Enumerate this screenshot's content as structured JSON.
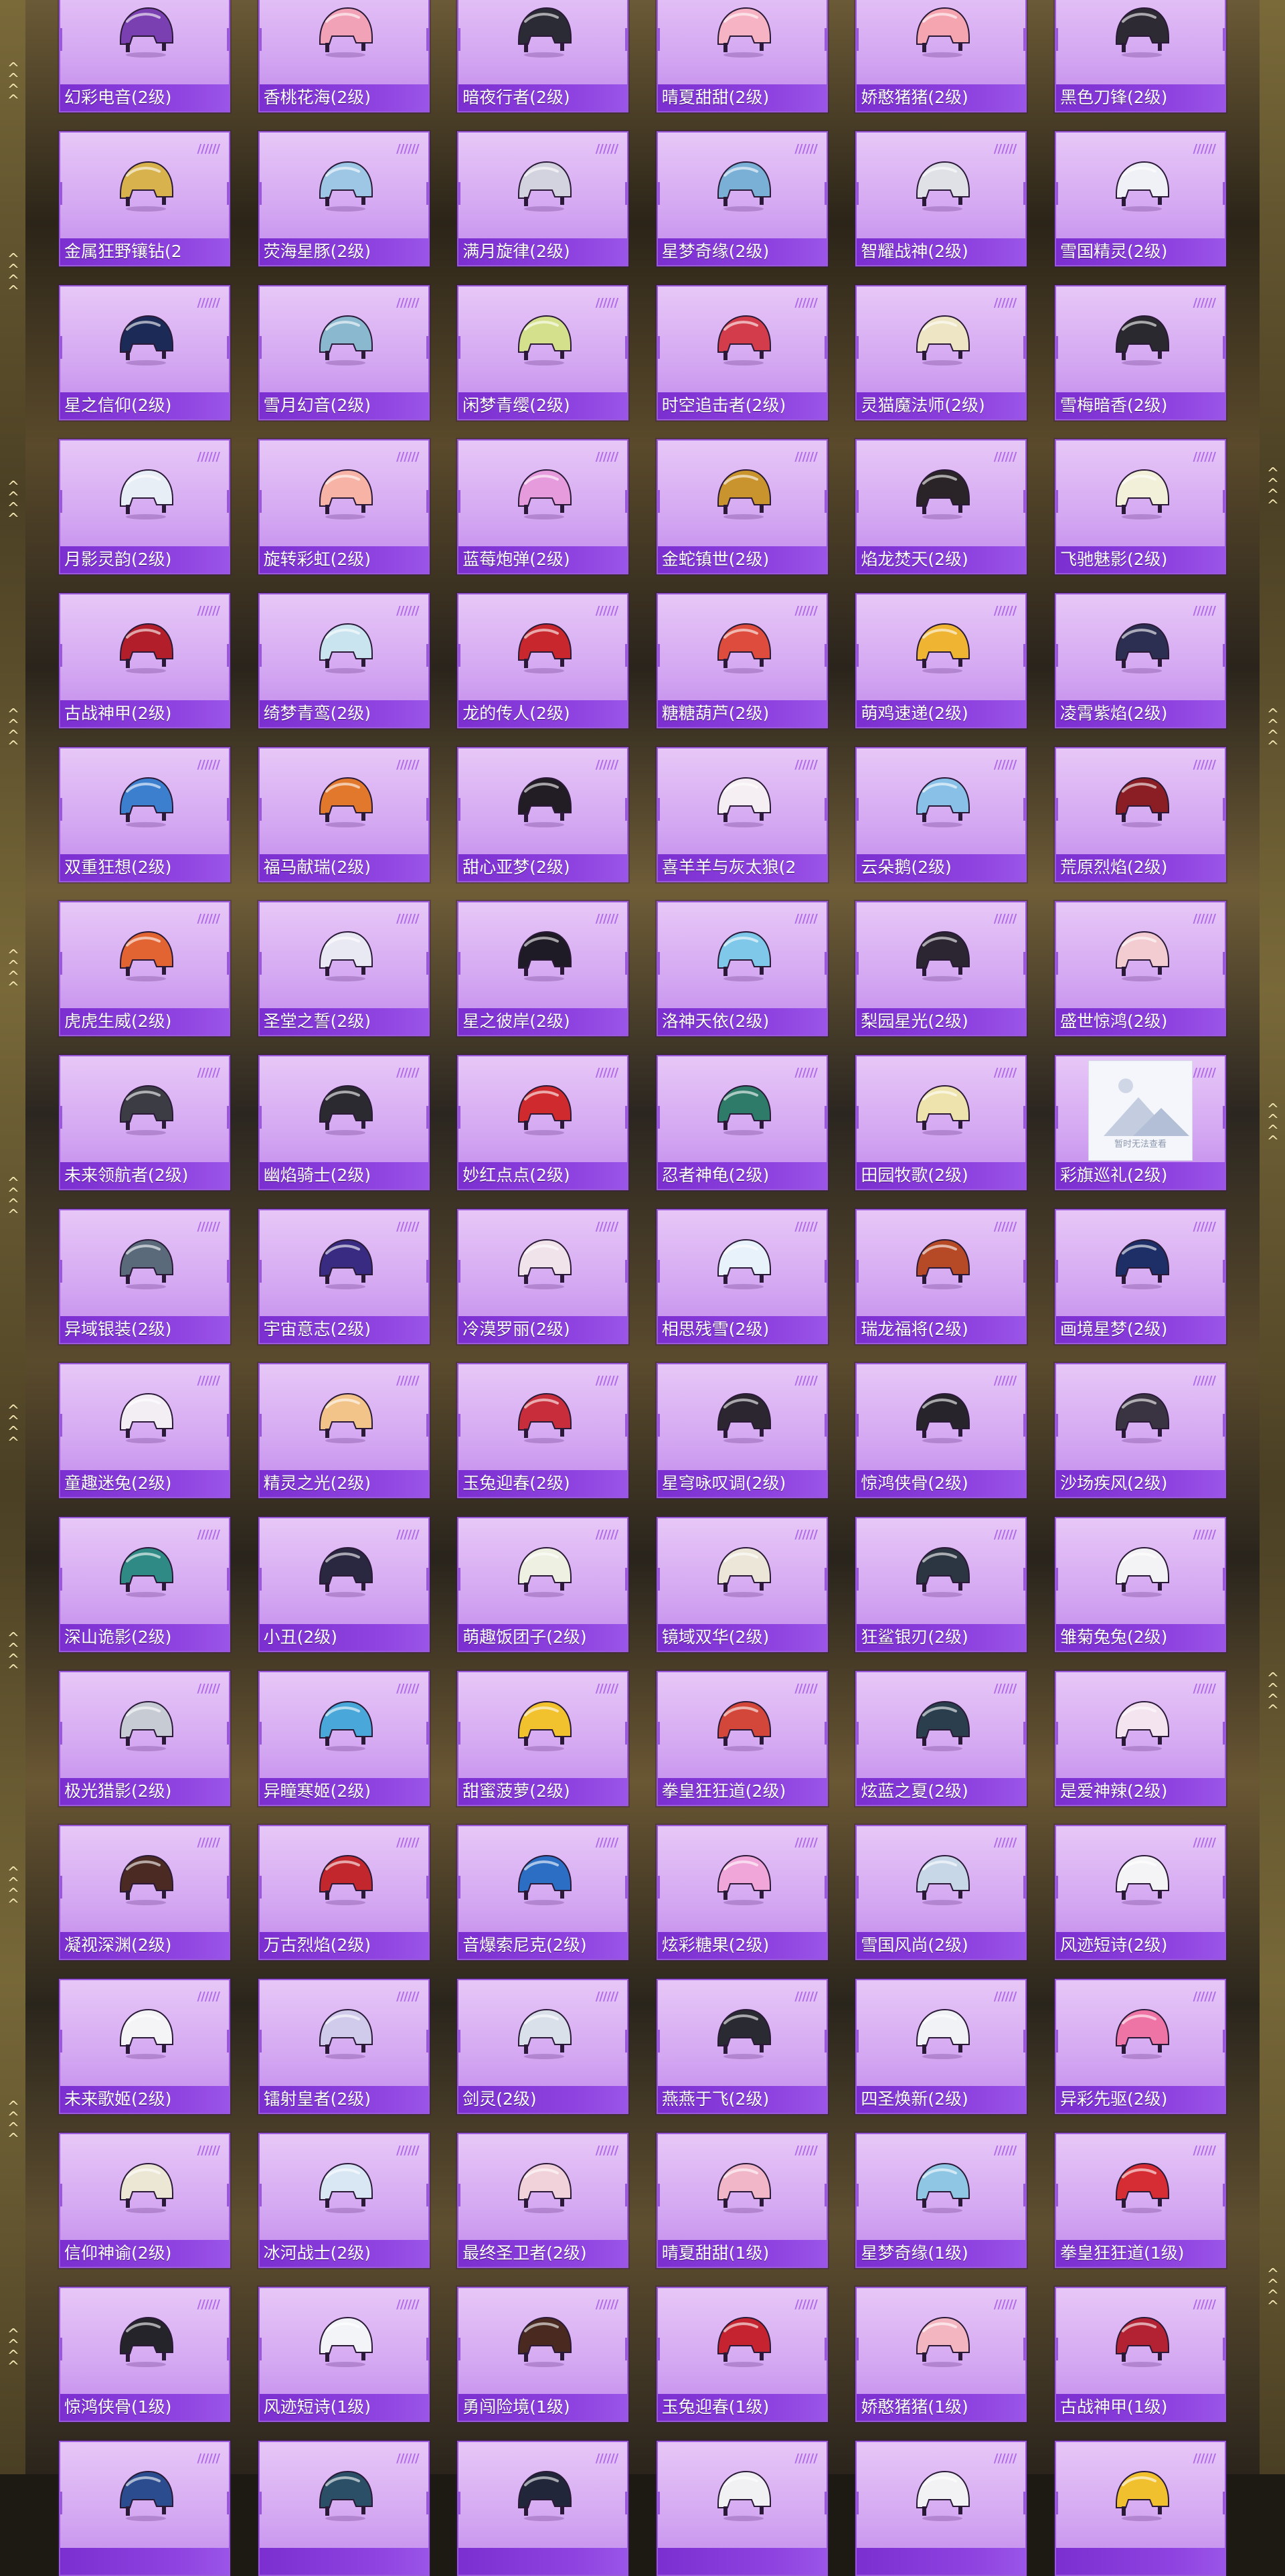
{
  "placeholder_text": "暂时无法查看",
  "items": [
    {
      "name": "幻彩电音(2级)",
      "color": "#7a3fb0"
    },
    {
      "name": "香桃花海(2级)",
      "color": "#f2a2b7"
    },
    {
      "name": "暗夜行者(2级)",
      "color": "#2b2b35"
    },
    {
      "name": "晴夏甜甜(2级)",
      "color": "#f5b3c3"
    },
    {
      "name": "娇憨猪猪(2级)",
      "color": "#f4a5b0"
    },
    {
      "name": "黑色刀锋(2级)",
      "color": "#2d2a34"
    },
    {
      "name": "金属狂野镶钻(2",
      "color": "#d8b24d"
    },
    {
      "name": "荧海星豚(2级)",
      "color": "#9ec7e6"
    },
    {
      "name": "满月旋律(2级)",
      "color": "#d3d3df"
    },
    {
      "name": "星梦奇缘(2级)",
      "color": "#7bb0d6"
    },
    {
      "name": "智耀战神(2级)",
      "color": "#dfe1e7"
    },
    {
      "name": "雪国精灵(2级)",
      "color": "#f0f1f6"
    },
    {
      "name": "星之信仰(2级)",
      "color": "#1c2a57"
    },
    {
      "name": "雪月幻音(2级)",
      "color": "#8ab8cf"
    },
    {
      "name": "闲梦青缨(2级)",
      "color": "#d4e08b"
    },
    {
      "name": "时空追击者(2级)",
      "color": "#d33d4b"
    },
    {
      "name": "灵猫魔法师(2级)",
      "color": "#eee5c4"
    },
    {
      "name": "雪梅暗香(2级)",
      "color": "#2b2930"
    },
    {
      "name": "月影灵韵(2级)",
      "color": "#e8eef6"
    },
    {
      "name": "旋转彩虹(2级)",
      "color": "#f7b3a6"
    },
    {
      "name": "蓝莓炮弹(2级)",
      "color": "#e69bdc"
    },
    {
      "name": "金蛇镇世(2级)",
      "color": "#c9932d"
    },
    {
      "name": "焰龙焚天(2级)",
      "color": "#2a2327"
    },
    {
      "name": "飞驰魅影(2级)",
      "color": "#f2f0d8"
    },
    {
      "name": "古战神甲(2级)",
      "color": "#b21f2a"
    },
    {
      "name": "绮梦青鸾(2级)",
      "color": "#c9e3ef"
    },
    {
      "name": "龙的传人(2级)",
      "color": "#c8282d"
    },
    {
      "name": "糖糖葫芦(2级)",
      "color": "#dd4c3c"
    },
    {
      "name": "萌鸡速递(2级)",
      "color": "#efb431"
    },
    {
      "name": "凌霄紫焰(2级)",
      "color": "#2d2f52"
    },
    {
      "name": "双重狂想(2级)",
      "color": "#3c7fcf"
    },
    {
      "name": "福马献瑞(2级)",
      "color": "#e2782c"
    },
    {
      "name": "甜心亚梦(2级)",
      "color": "#221d24"
    },
    {
      "name": "喜羊羊与灰太狼(2",
      "color": "#f5eef2"
    },
    {
      "name": "云朵鹅(2级)",
      "color": "#88c0e7"
    },
    {
      "name": "荒原烈焰(2级)",
      "color": "#8b1e25"
    },
    {
      "name": "虎虎生威(2级)",
      "color": "#e16432"
    },
    {
      "name": "圣堂之誓(2级)",
      "color": "#e9e9f4"
    },
    {
      "name": "星之彼岸(2级)",
      "color": "#1f1b26"
    },
    {
      "name": "洛神天依(2级)",
      "color": "#7fc8e9"
    },
    {
      "name": "梨园星光(2级)",
      "color": "#2b2631"
    },
    {
      "name": "盛世惊鸿(2级)",
      "color": "#f2ccd1"
    },
    {
      "name": "未来领航者(2级)",
      "color": "#3b3c44"
    },
    {
      "name": "幽焰骑士(2级)",
      "color": "#2b2a31"
    },
    {
      "name": "妙红点点(2级)",
      "color": "#cf2b2f"
    },
    {
      "name": "忍者神龟(2级)",
      "color": "#2f7b6a"
    },
    {
      "name": "田园牧歌(2级)",
      "color": "#eee3ad"
    },
    {
      "name": "彩旗巡礼(2级)",
      "color": "#f5f6fb",
      "placeholder": true
    },
    {
      "name": "异域银装(2级)",
      "color": "#5a6a7a"
    },
    {
      "name": "宇宙意志(2级)",
      "color": "#3a2b82"
    },
    {
      "name": "冷漠罗丽(2级)",
      "color": "#f1e3ea"
    },
    {
      "name": "相思残雪(2级)",
      "color": "#e8f2fa"
    },
    {
      "name": "瑞龙福将(2级)",
      "color": "#b64a26"
    },
    {
      "name": "画境星梦(2级)",
      "color": "#1d2f66"
    },
    {
      "name": "童趣迷兔(2级)",
      "color": "#f3eef3"
    },
    {
      "name": "精灵之光(2级)",
      "color": "#f2c48a"
    },
    {
      "name": "玉兔迎春(2级)",
      "color": "#c82d3b"
    },
    {
      "name": "星穹咏叹调(2级)",
      "color": "#2c2631"
    },
    {
      "name": "惊鸿侠骨(2级)",
      "color": "#27252b"
    },
    {
      "name": "沙场疾风(2级)",
      "color": "#3a3442"
    },
    {
      "name": "深山诡影(2级)",
      "color": "#2f8a86"
    },
    {
      "name": "小丑(2级)",
      "color": "#2a2740"
    },
    {
      "name": "萌趣饭团子(2级)",
      "color": "#eef0e1"
    },
    {
      "name": "镜域双华(2级)",
      "color": "#ece6d8"
    },
    {
      "name": "狂鲨银刃(2级)",
      "color": "#2c3542"
    },
    {
      "name": "雏菊兔兔(2级)",
      "color": "#f3f3f5"
    },
    {
      "name": "极光猎影(2级)",
      "color": "#c7cbd4"
    },
    {
      "name": "异瞳寒姬(2级)",
      "color": "#4aa7d9"
    },
    {
      "name": "甜蜜菠萝(2级)",
      "color": "#f1c12e"
    },
    {
      "name": "拳皇狂狂道(2级)",
      "color": "#d3473a"
    },
    {
      "name": "炫蓝之夏(2级)",
      "color": "#2a3e4e"
    },
    {
      "name": "是爱神辣(2级)",
      "color": "#f3e4ef"
    },
    {
      "name": "凝视深渊(2级)",
      "color": "#4a2a22"
    },
    {
      "name": "万古烈焰(2级)",
      "color": "#c3272e"
    },
    {
      "name": "音爆索尼克(2级)",
      "color": "#2b6ec4"
    },
    {
      "name": "炫彩糖果(2级)",
      "color": "#f0a6d8"
    },
    {
      "name": "雪国风尚(2级)",
      "color": "#c8d7e8"
    },
    {
      "name": "风迹短诗(2级)",
      "color": "#f4f4f6"
    },
    {
      "name": "未来歌姬(2级)",
      "color": "#f4f4f6"
    },
    {
      "name": "镭射皇者(2级)",
      "color": "#d0cbea"
    },
    {
      "name": "剑灵(2级)",
      "color": "#d9e0ea"
    },
    {
      "name": "燕燕于飞(2级)",
      "color": "#2a2a32"
    },
    {
      "name": "四圣焕新(2级)",
      "color": "#f1f2f5"
    },
    {
      "name": "异彩先驱(2级)",
      "color": "#ee74a6"
    },
    {
      "name": "信仰神谕(2级)",
      "color": "#ece6d5"
    },
    {
      "name": "冰河战士(2级)",
      "color": "#d8e7f3"
    },
    {
      "name": "最终圣卫者(2级)",
      "color": "#f1d1da"
    },
    {
      "name": "晴夏甜甜(1级)",
      "color": "#f1b7c8"
    },
    {
      "name": "星梦奇缘(1级)",
      "color": "#8ec6e3"
    },
    {
      "name": "拳皇狂狂道(1级)",
      "color": "#d62c34"
    },
    {
      "name": "惊鸿侠骨(1级)",
      "color": "#26242b"
    },
    {
      "name": "风迹短诗(1级)",
      "color": "#f2f4f7"
    },
    {
      "name": "勇闯险境(1级)",
      "color": "#4a2a20"
    },
    {
      "name": "玉兔迎春(1级)",
      "color": "#c4232f"
    },
    {
      "name": "娇憨猪猪(1级)",
      "color": "#f3b6c1"
    },
    {
      "name": "古战神甲(1级)",
      "color": "#b32233"
    },
    {
      "name": "",
      "color": "#2b4c8f"
    },
    {
      "name": "",
      "color": "#2b4f66"
    },
    {
      "name": "",
      "color": "#22263a"
    },
    {
      "name": "",
      "color": "#f1f0f2"
    },
    {
      "name": "",
      "color": "#f2f2f5"
    },
    {
      "name": "",
      "color": "#f1c02f"
    }
  ]
}
